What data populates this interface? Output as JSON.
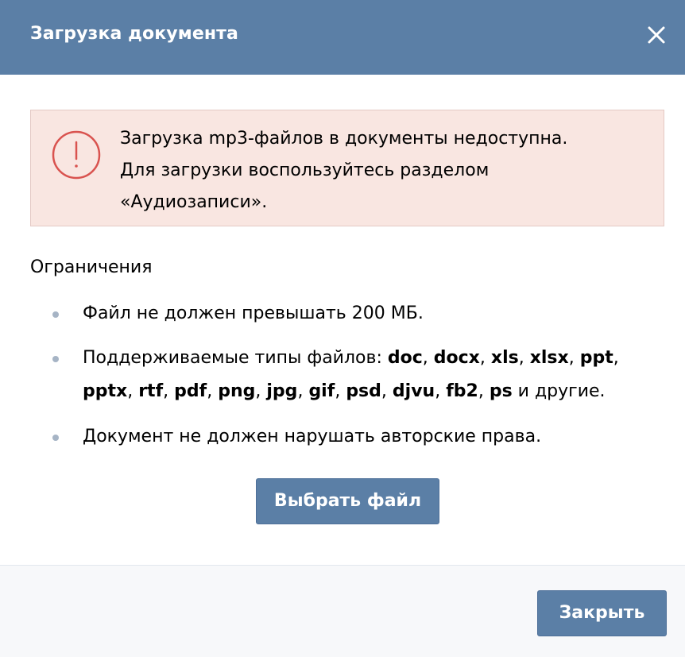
{
  "modal": {
    "title": "Загрузка документа",
    "close_icon": "close-icon"
  },
  "alert": {
    "icon": "exclamation-circle-icon",
    "lines": [
      "Загрузка mp3-файлов в документы недоступна.",
      "Для загрузки воспользуйтесь разделом",
      "«Аудиозаписи»."
    ]
  },
  "limits": {
    "title": "Ограничения",
    "size_text": "Файл не должен превышать 200 МБ.",
    "types": {
      "prefix": "Поддерживаемые типы файлов: ",
      "formats": [
        "doc",
        "docx",
        "xls",
        "xlsx",
        "ppt",
        "pptx",
        "rtf",
        "pdf",
        "png",
        "jpg",
        "gif",
        "psd",
        "djvu",
        "fb2",
        "ps"
      ],
      "separator": ", ",
      "suffix": " и другие."
    },
    "copyright_text": "Документ не должен нарушать авторские права."
  },
  "buttons": {
    "select_file": "Выбрать файл",
    "close": "Закрыть"
  },
  "colors": {
    "header": "#5b7fa6",
    "alert_bg": "#f9e6e1",
    "alert_icon": "#d9534f",
    "bullet": "#a6b4c5",
    "button": "#5b7fa6"
  }
}
